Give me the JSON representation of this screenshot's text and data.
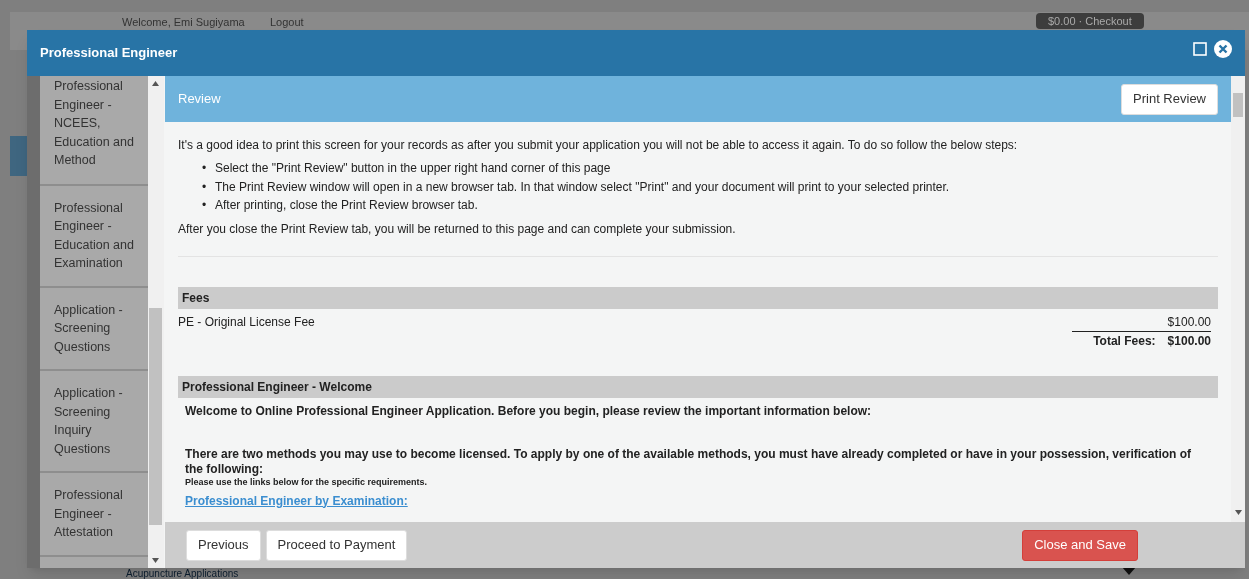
{
  "background_page": {
    "welcome": "Welcome, Emi Sugiyama",
    "logout": "Logout",
    "cart": "$0.00 · Checkout",
    "section_title": "Acupuncture Applications"
  },
  "window": {
    "title": "Professional Engineer"
  },
  "sidebar": {
    "items": [
      {
        "label": "Professional Engineer - NCEES, Education and Method",
        "selected": false
      },
      {
        "label": "Professional Engineer - Education and Examination",
        "selected": false
      },
      {
        "label": "Application - Screening Questions",
        "selected": false
      },
      {
        "label": "Application - Screening Inquiry Questions",
        "selected": false
      },
      {
        "label": "Professional Engineer - Attestation",
        "selected": false
      }
    ]
  },
  "review": {
    "title": "Review",
    "print_button": "Print Review",
    "intro": "It's a good idea to print this screen for your records as after you submit your application you will not be able to access it again. To do so follow the below steps:",
    "steps": [
      {
        "marker": "•",
        "text": "Select the \"Print Review\" button in the upper right hand corner of this page"
      },
      {
        "marker": "•",
        "text": "The Print Review window will open in a new browser tab. In that window select \"Print\" and your document will print to your selected printer."
      },
      {
        "marker": "•",
        "text": "After printing, close the Print Review browser tab."
      }
    ],
    "outro": "After you close the Print Review tab, you will be returned to this page and can complete your submission."
  },
  "fees": {
    "title": "Fees",
    "items": [
      {
        "name": "PE - Original License Fee",
        "amount": "$100.00"
      }
    ],
    "total_label": "Total Fees:",
    "total": "$100.00"
  },
  "welcome_section": {
    "title": "Professional Engineer - Welcome",
    "lead": "Welcome to Online Professional Engineer Application. Before you begin, please review the important information below:",
    "methods": "There are two methods you may use to become licensed. To apply by one of the available methods, you must have already completed or have in your possession, verification of the following:",
    "note": "Please use the links below for the specific requirements.",
    "link": "Professional Engineer by Examination:"
  },
  "footer": {
    "buttons": [
      {
        "label": "Previous",
        "kind": "plain"
      },
      {
        "label": "Proceed to Payment",
        "kind": "plain"
      },
      {
        "label": "Close and Save",
        "kind": "danger"
      }
    ]
  }
}
